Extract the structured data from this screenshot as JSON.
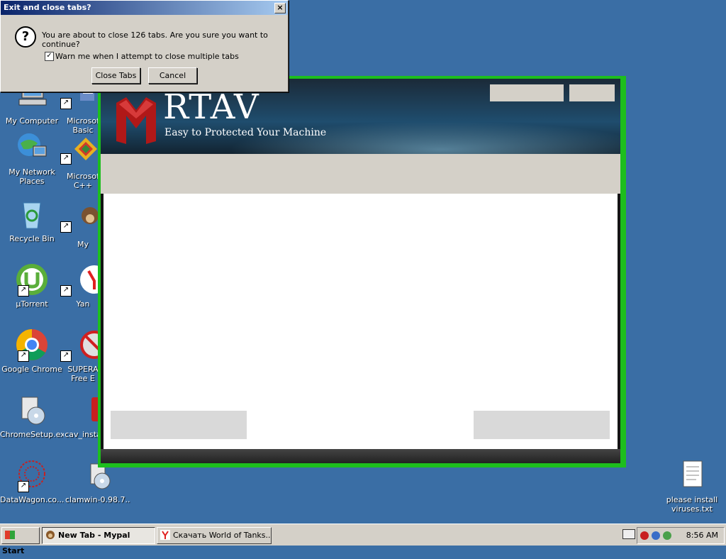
{
  "dialog": {
    "title": "Exit and close tabs?",
    "close_glyph": "×",
    "message": "You are about to close 126 tabs. Are you sure you want to continue?",
    "warn_label": "Warn me when I attempt to close multiple tabs",
    "warn_checked": true,
    "close_tabs_label": "Close Tabs",
    "cancel_label": "Cancel"
  },
  "desktop": {
    "icons": [
      {
        "label": "My Computer",
        "icon": "computer-icon"
      },
      {
        "label": "Microsoft Visual Basic",
        "label_line1": "Microsof",
        "label_line2": "Basic",
        "icon": "visual-basic-icon"
      },
      {
        "label": "My Network Places",
        "label_line1": "My Network",
        "label_line2": "Places",
        "icon": "network-places-icon"
      },
      {
        "label": "Microsoft Visual C++",
        "label_line1": "Microsof",
        "label_line2": "C++",
        "icon": "visual-cpp-icon"
      },
      {
        "label": "Recycle Bin",
        "icon": "recycle-bin-icon"
      },
      {
        "label": "My",
        "icon": "monkey-icon"
      },
      {
        "label": "µTorrent",
        "icon": "utorrent-icon"
      },
      {
        "label": "Yan",
        "icon": "yandex-icon"
      },
      {
        "label": "Google Chrome",
        "icon": "chrome-icon"
      },
      {
        "label": "SUPERAntiSpyware Free Edition",
        "label_line1": "SUPERA",
        "label_line2": "Free E",
        "icon": "superantispyware-icon"
      },
      {
        "label": "ChromeSetup.exe",
        "icon": "installer-icon"
      },
      {
        "label": "cav_insta",
        "icon": "cav-installer-icon"
      },
      {
        "label": "DataWagon.co...",
        "icon": "datawagon-icon"
      },
      {
        "label": "clamwin-0.98.7...",
        "icon": "clamwin-installer-icon"
      },
      {
        "label_line1": "please install",
        "label_line2": "viruses.txt",
        "icon": "text-file-icon"
      }
    ]
  },
  "rtav": {
    "title": "RTAV",
    "subtitle": "Easy to Protected Your Machine"
  },
  "taskbar": {
    "start_label": "Start",
    "tasks": [
      {
        "label": "New Tab - Mypal",
        "active": true
      },
      {
        "label": "Скачать World of Tanks...",
        "active": false
      }
    ],
    "clock": "8:56 AM"
  },
  "colors": {
    "desktop_bg": "#3a6ea5",
    "window_border_green": "#1dbe1d",
    "dialog_title_blue": "#0a246a"
  }
}
